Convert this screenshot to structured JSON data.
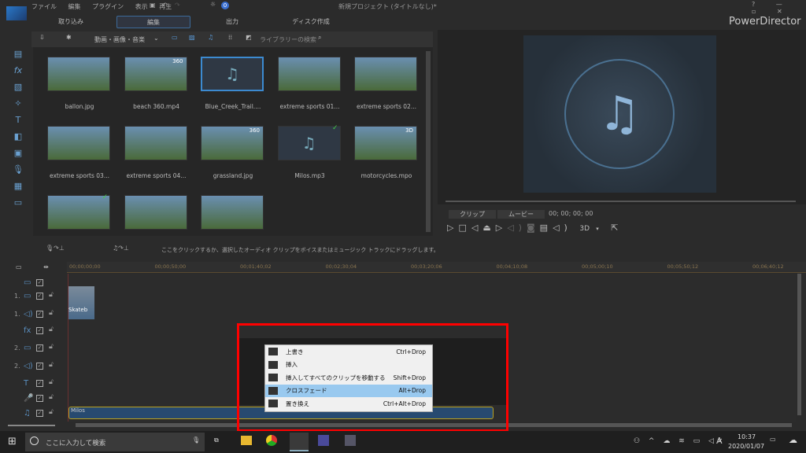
{
  "app": {
    "title": "新規プロジェクト (タイトルなし)*",
    "brand": "PowerDirector",
    "badge": "0"
  },
  "menu": [
    "ファイル",
    "編集",
    "プラグイン",
    "表示",
    "再生"
  ],
  "tabs": [
    {
      "label": "取り込み"
    },
    {
      "label": "編集",
      "active": true
    },
    {
      "label": "出力"
    },
    {
      "label": "ディスク作成"
    }
  ],
  "library": {
    "filter": "動画・画像・音楽",
    "search_placeholder": "ライブラリーの検索",
    "items": [
      {
        "label": "ballon.jpg",
        "type": "image"
      },
      {
        "label": "beach 360.mp4",
        "type": "video",
        "badge": "360"
      },
      {
        "label": "Blue_Creek_Trail....",
        "type": "music",
        "selected": true
      },
      {
        "label": "extreme sports 01...",
        "type": "image"
      },
      {
        "label": "extreme sports 02...",
        "type": "image"
      },
      {
        "label": "extreme sports 03...",
        "type": "image"
      },
      {
        "label": "extreme sports 04...",
        "type": "image"
      },
      {
        "label": "grassland.jpg",
        "type": "image",
        "badge": "360"
      },
      {
        "label": "Milos.mp3",
        "type": "music",
        "check": true
      },
      {
        "label": "motorcycles.mpo",
        "type": "image",
        "badge": "3D"
      },
      {
        "label": "",
        "type": "image",
        "check": true
      },
      {
        "label": "",
        "type": "image"
      },
      {
        "label": "",
        "type": "image"
      }
    ]
  },
  "preview": {
    "clip_tab": "クリップ",
    "movie_tab": "ムービー",
    "timecode": "00; 00; 00; 00",
    "mode_3d": "3D"
  },
  "audio_hint": "ここをクリックするか、選択したオーディオ クリップをボイスまたはミュージック トラックにドラッグします。",
  "timeline": {
    "ticks": [
      "00;00;00;00",
      "00;00;50;00",
      "00;01;40;02",
      "00;02;30;04",
      "00;03;20;06",
      "00;04;10;08",
      "00;05;00;10",
      "00;05;50;12",
      "00;06;40;12"
    ],
    "tracks": [
      {
        "num": "",
        "icon": "▭"
      },
      {
        "num": "1.",
        "icon": "▭"
      },
      {
        "num": "1.",
        "icon": "◁)"
      },
      {
        "num": "",
        "icon": "fx"
      },
      {
        "num": "2.",
        "icon": "▭"
      },
      {
        "num": "2.",
        "icon": "◁)"
      },
      {
        "num": "",
        "icon": "T"
      },
      {
        "num": "",
        "icon": "🎤"
      },
      {
        "num": "",
        "icon": "♫"
      }
    ],
    "clip_video": "Skateb",
    "clip_music": "Milos"
  },
  "context_menu": [
    {
      "label": "上書き",
      "shortcut": "Ctrl+Drop"
    },
    {
      "label": "挿入",
      "shortcut": ""
    },
    {
      "label": "挿入してすべてのクリップを移動する",
      "shortcut": "Shift+Drop"
    },
    {
      "label": "クロスフェード",
      "shortcut": "Alt+Drop",
      "highlighted": true
    },
    {
      "label": "置き換え",
      "shortcut": "Ctrl+Alt+Drop"
    }
  ],
  "taskbar": {
    "search_placeholder": "ここに入力して検索",
    "time": "10:37",
    "date": "2020/01/07",
    "ime": "A"
  },
  "colors": {
    "accent": "#3c6a99",
    "highlight": "#99c9ef",
    "annotation": "#ff0000"
  }
}
